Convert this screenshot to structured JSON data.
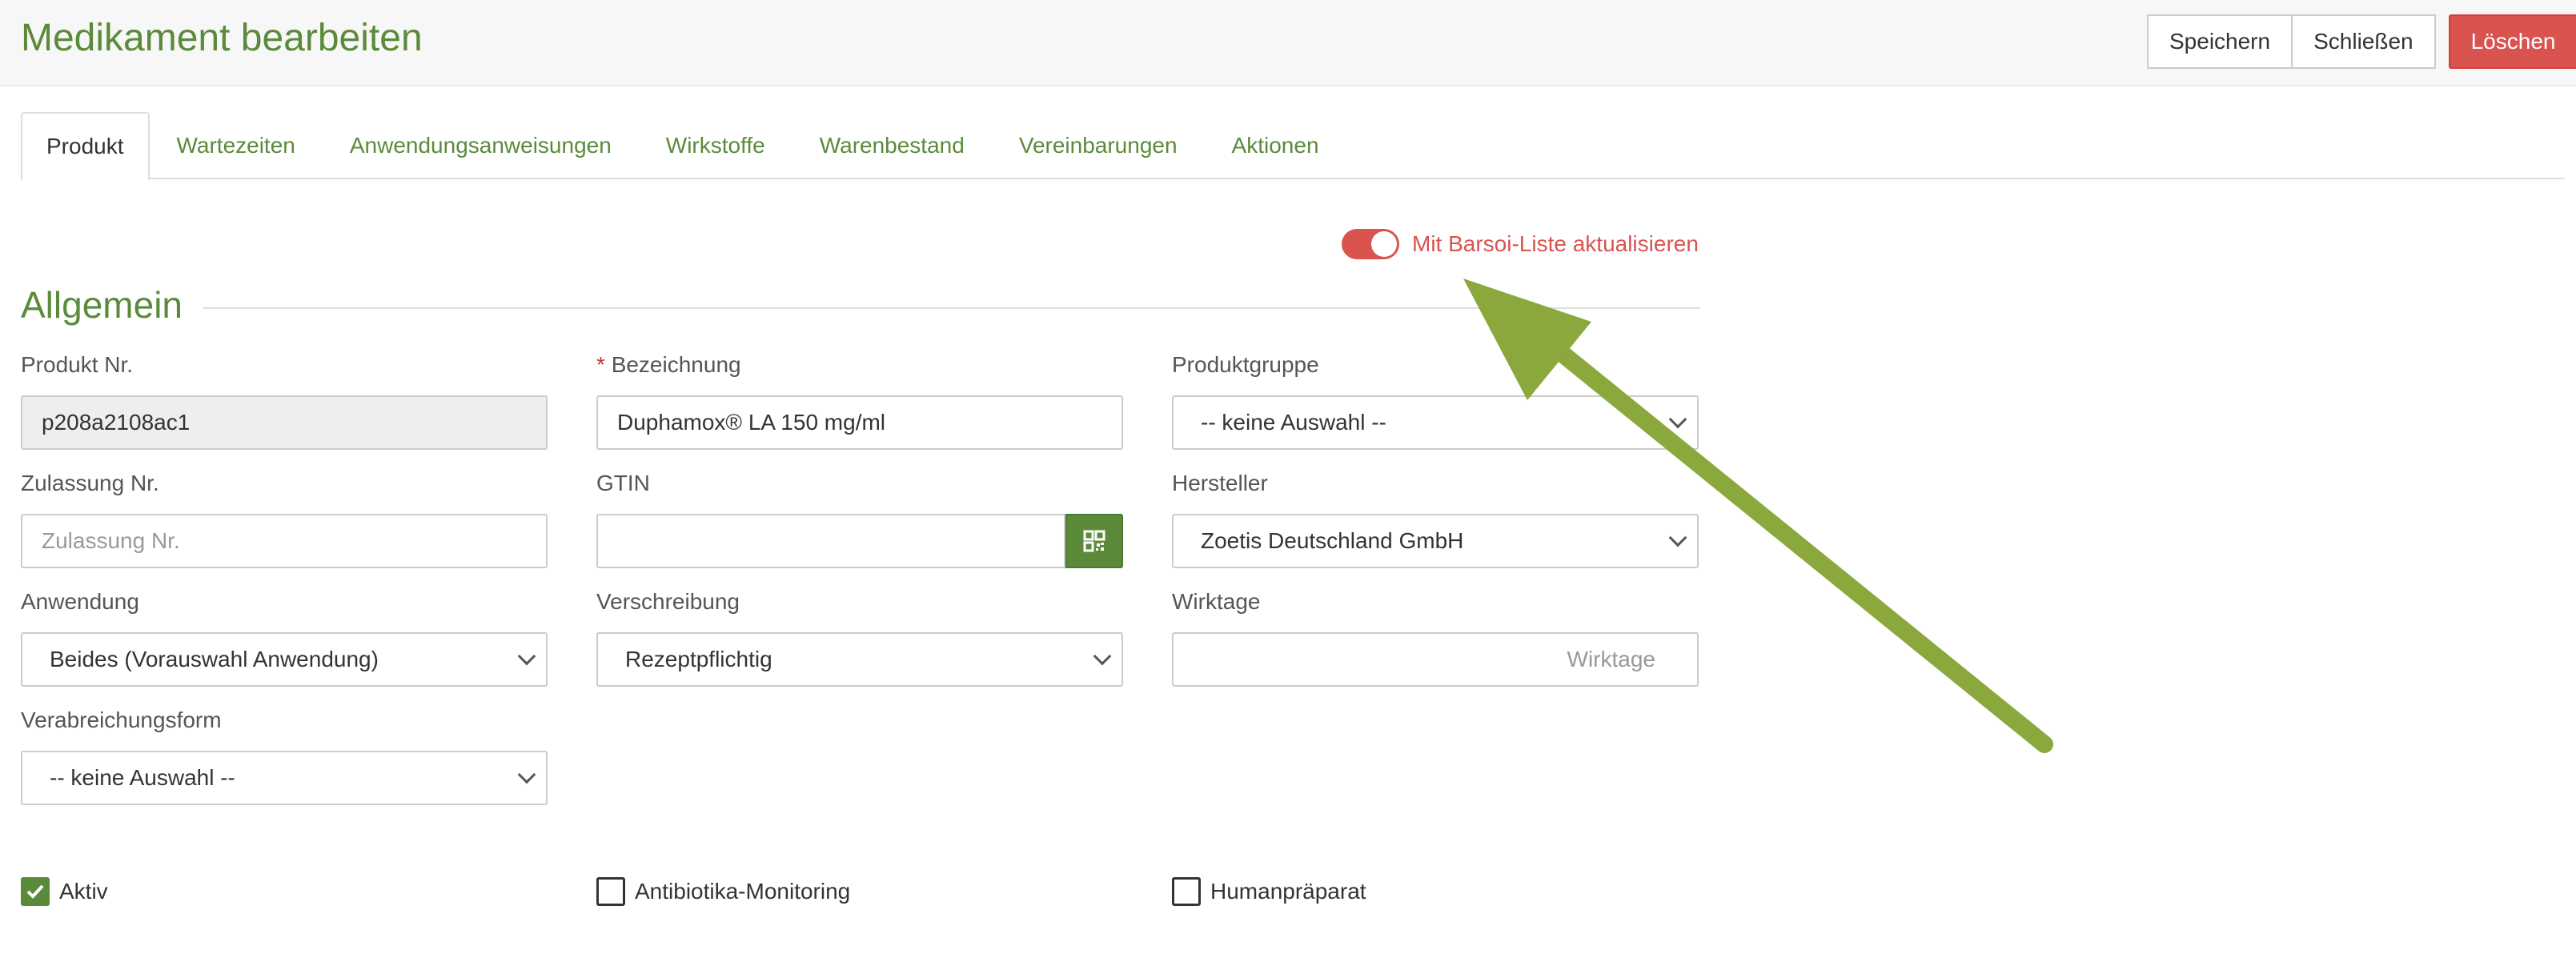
{
  "header": {
    "title": "Medikament bearbeiten",
    "buttons": {
      "save": "Speichern",
      "close": "Schließen",
      "delete": "Löschen"
    }
  },
  "tabs": [
    "Produkt",
    "Wartezeiten",
    "Anwendungsanweisungen",
    "Wirkstoffe",
    "Warenbestand",
    "Vereinbarungen",
    "Aktionen"
  ],
  "active_tab": "Produkt",
  "toggle": {
    "label": "Mit Barsoi-Liste aktualisieren",
    "on": true
  },
  "section": {
    "title": "Allgemein"
  },
  "fields": {
    "produkt_nr": {
      "label": "Produkt Nr.",
      "value": "p208a2108ac1"
    },
    "bezeichnung": {
      "required_mark": "*",
      "label": "Bezeichnung",
      "value": "Duphamox® LA 150 mg/ml"
    },
    "produktgruppe": {
      "label": "Produktgruppe",
      "value": "-- keine Auswahl --"
    },
    "zulassung_nr": {
      "label": "Zulassung Nr.",
      "placeholder": "Zulassung Nr."
    },
    "gtin": {
      "label": "GTIN",
      "value": ""
    },
    "hersteller": {
      "label": "Hersteller",
      "value": "Zoetis Deutschland GmbH"
    },
    "anwendung": {
      "label": "Anwendung",
      "value": "Beides (Vorauswahl Anwendung)"
    },
    "verschreibung": {
      "label": "Verschreibung",
      "value": "Rezeptpflichtig"
    },
    "wirktage": {
      "label": "Wirktage",
      "placeholder": "Wirktage"
    },
    "verabreichungsform": {
      "label": "Verabreichungsform",
      "value": "-- keine Auswahl --"
    }
  },
  "checkboxes": {
    "aktiv": {
      "label": "Aktiv",
      "checked": true
    },
    "antibiotika": {
      "label": "Antibiotika-Monitoring",
      "checked": false
    },
    "human": {
      "label": "Humanpräparat",
      "checked": false
    }
  },
  "colors": {
    "accent": "#5b8a3a",
    "danger": "#d9534f",
    "arrow": "#8aa83b"
  },
  "icons": {
    "qr": "qr-code-icon",
    "chevron": "chevron-down-icon",
    "check": "check-icon"
  }
}
